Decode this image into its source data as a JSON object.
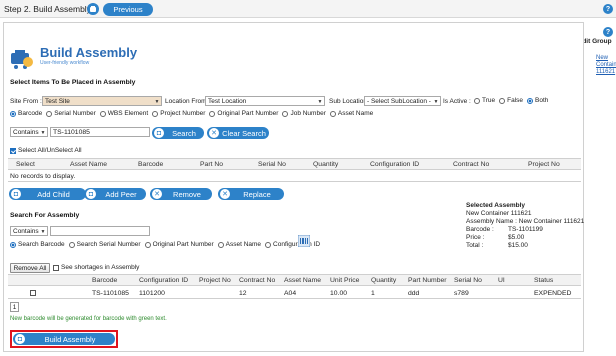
{
  "header": {
    "step_title": "Step 2. Build Assembly",
    "previous_label": "Previous"
  },
  "side": {
    "edit_group_label": "Edit Group",
    "container_link": "New Container 111621"
  },
  "logo": {
    "title": "Build Assembly",
    "subtitle": "User-friendly workflow"
  },
  "select_items": {
    "section_title": "Select Items To Be Placed in Assembly",
    "site_from_label": "Site From :",
    "site_value": "Test Site",
    "location_from_label": "Location From",
    "location_value": "Test Location",
    "sub_location_label": "Sub Location",
    "sub_location_value": "- Select SubLocation -",
    "is_active_label": "Is Active :",
    "is_active_options": [
      "True",
      "False",
      "Both"
    ],
    "is_active_selected": "Both",
    "search_by_options": [
      "Barcode",
      "Serial Number",
      "WBS Element",
      "Project Number",
      "Original Part Number",
      "Job Number",
      "Asset Name"
    ],
    "search_by_selected": "Barcode",
    "match_mode": "Contains",
    "search_value": "TS-1101085",
    "search_label": "Search",
    "clear_label": "Clear Search",
    "select_all_label": "Select All/UnSelect All",
    "columns": [
      "Select",
      "Asset Name",
      "Barcode",
      "Part No",
      "Serial No",
      "Quantity",
      "Configuration ID",
      "Contract No",
      "Project No"
    ],
    "empty_text": "No records to display.",
    "actions": {
      "add_child": "Add Child",
      "add_peer": "Add Peer",
      "remove": "Remove",
      "replace": "Replace"
    }
  },
  "selected_assembly": {
    "title": "Selected Assembly",
    "name": "New Container 111621",
    "assembly_name_label": "Assembly Name :",
    "assembly_name_value": "New Container 111621",
    "barcode_label": "Barcode :",
    "barcode_value": "TS-1101199",
    "price_label": "Price :",
    "price_value": "$5.00",
    "total_label": "Total :",
    "total_value": "$15.00"
  },
  "search_assembly": {
    "section_title": "Search For Assembly",
    "match_mode": "Contains",
    "search_value": "",
    "search_by_options": [
      "Search Barcode",
      "Search Serial Number",
      "Original Part Number",
      "Asset Name",
      "Configuration ID"
    ],
    "search_by_selected": "Search Barcode",
    "remove_all_label": "Remove All",
    "shortage_label": "See shortages in Assembly",
    "columns": [
      "Barcode",
      "Configuration ID",
      "Project No",
      "Contract No",
      "Asset Name",
      "Unit Price",
      "Quantity",
      "Part Number",
      "Serial No",
      "UI",
      "Status"
    ],
    "rows": [
      {
        "barcode": "TS-1101085",
        "configuration_id": "1101200",
        "project_no": "",
        "contract_no": "12",
        "asset_name": "A04",
        "unit_price": "10.00",
        "quantity": "1",
        "part_number": "ddd",
        "serial_no": "s789",
        "ui": "",
        "status": "EXPENDED"
      }
    ],
    "page_number": "1",
    "note": "New barcode will be generated for barcode with green text.",
    "build_label": "Build Assembly"
  },
  "colors": {
    "accent": "#2d82c9",
    "highlight": "#e0141e",
    "note": "#2e8b2e",
    "tan_field": "#f0dfc9"
  }
}
